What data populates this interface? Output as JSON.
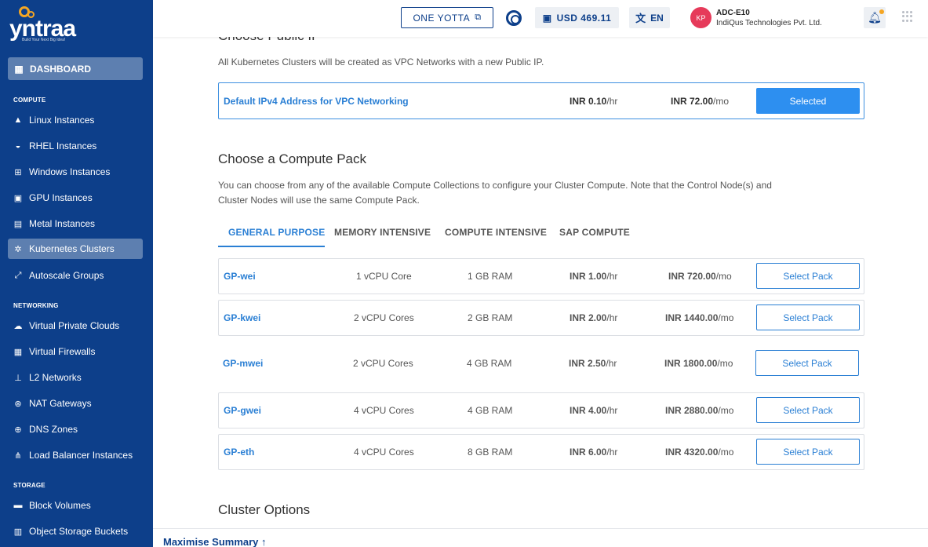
{
  "brand": {
    "name": "yntraa",
    "tagline": "Build Your Next Big Idea!"
  },
  "sidebar": {
    "dashboard": "DASHBOARD",
    "sections": [
      {
        "title": "COMPUTE",
        "items": [
          "Linux Instances",
          "RHEL Instances",
          "Windows Instances",
          "GPU Instances",
          "Metal Instances",
          "Kubernetes Clusters",
          "Autoscale Groups"
        ]
      },
      {
        "title": "NETWORKING",
        "items": [
          "Virtual Private Clouds",
          "Virtual Firewalls",
          "L2 Networks",
          "NAT Gateways",
          "DNS Zones",
          "Load Balancer Instances"
        ]
      },
      {
        "title": "STORAGE",
        "items": [
          "Block Volumes",
          "Object Storage Buckets"
        ]
      }
    ],
    "active_item": "Kubernetes Clusters"
  },
  "topbar": {
    "yotta_button": "ONE YOTTA",
    "balance": "USD 469.11",
    "language": "EN",
    "avatar_initials": "KP",
    "account_name": "ADC-E10",
    "account_org": "IndiQus Technologies Pvt. Ltd."
  },
  "public_ip": {
    "heading": "Choose Public IP",
    "description": "All Kubernetes Clusters will be created as VPC Networks with a new Public IP.",
    "option": {
      "name": "Default IPv4 Address for VPC Networking",
      "price_hr": "INR 0.10",
      "price_mo": "INR 72.00",
      "button": "Selected"
    }
  },
  "compute_pack": {
    "heading": "Choose a Compute Pack",
    "description_line1": "You can choose from any of the available Compute Collections to configure your Cluster Compute. Note that the Control Node(s) and",
    "description_line2": "Cluster Nodes will use the same Compute Pack.",
    "tabs": [
      "GENERAL PURPOSE",
      "MEMORY INTENSIVE",
      "COMPUTE INTENSIVE",
      "SAP COMPUTE"
    ],
    "active_tab": "GENERAL PURPOSE",
    "hr_unit": "/hr",
    "mo_unit": "/mo",
    "packs": [
      {
        "name": "GP-wei",
        "cpu": "1 vCPU Core",
        "ram": "1 GB RAM",
        "price_hr": "INR 1.00",
        "price_mo": "INR 720.00",
        "button": "Select Pack"
      },
      {
        "name": "GP-kwei",
        "cpu": "2 vCPU Cores",
        "ram": "2 GB RAM",
        "price_hr": "INR 2.00",
        "price_mo": "INR 1440.00",
        "button": "Select Pack"
      },
      {
        "name": "GP-mwei",
        "cpu": "2 vCPU Cores",
        "ram": "4 GB RAM",
        "price_hr": "INR 2.50",
        "price_mo": "INR 1800.00",
        "button": "Select Pack"
      },
      {
        "name": "GP-gwei",
        "cpu": "4 vCPU Cores",
        "ram": "4 GB RAM",
        "price_hr": "INR 4.00",
        "price_mo": "INR 2880.00",
        "button": "Select Pack"
      },
      {
        "name": "GP-eth",
        "cpu": "4 vCPU Cores",
        "ram": "8 GB RAM",
        "price_hr": "INR 6.00",
        "price_mo": "INR 4320.00",
        "button": "Select Pack"
      }
    ]
  },
  "cluster_options": {
    "heading": "Cluster Options"
  },
  "summary_bar": {
    "label": "Maximise Summary ↑"
  },
  "colors": {
    "sidebar": "#0d3f8a",
    "accent": "#2d8ff0",
    "link": "#2a7fd4"
  }
}
